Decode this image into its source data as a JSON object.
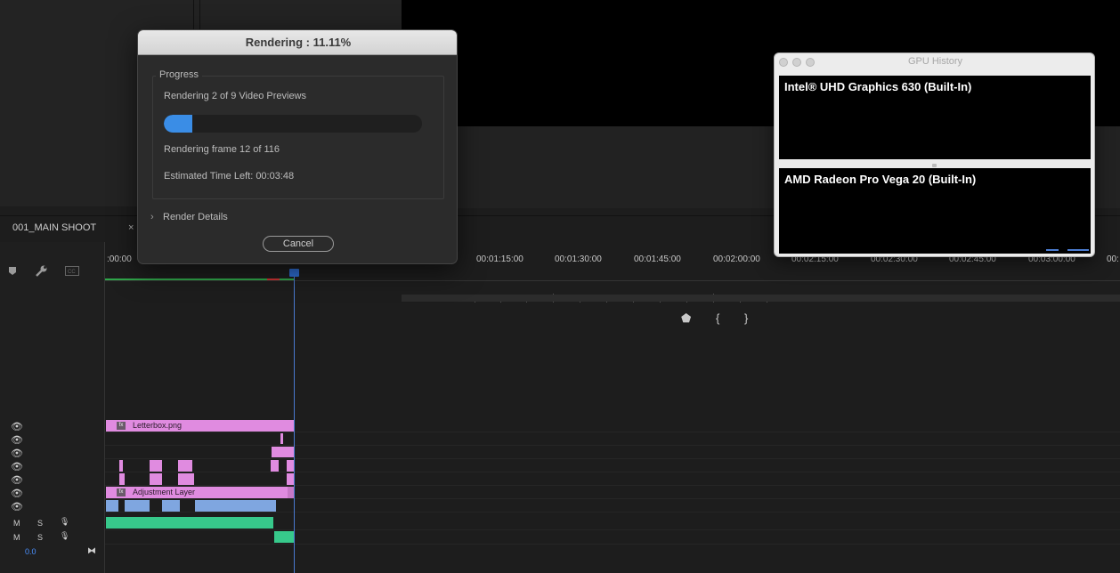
{
  "rendering_dialog": {
    "title": "Rendering : 11.11%",
    "progress_section_label": "Progress",
    "previews_text": "Rendering 2 of 9 Video Previews",
    "progress_percent": 11.11,
    "frame_text": "Rendering frame 12 of 116",
    "time_left_text": "Estimated Time Left: 00:03:48",
    "details_label": "Render Details",
    "cancel_label": "Cancel"
  },
  "gpu_history": {
    "title": "GPU History",
    "gpu1": "Intel® UHD Graphics 630 (Built-In)",
    "gpu2": "AMD Radeon Pro Vega 20 (Built-In)"
  },
  "timeline": {
    "sequence_tab": "001_MAIN SHOOT",
    "close_glyph": "×",
    "timecodes": [
      ":00:00",
      "00:01:15:00",
      "00:01:30:00",
      "00:01:45:00",
      "00:02:00:00",
      "00:02:15:00",
      "00:02:30:00",
      "00:02:45:00",
      "00:03:00:00",
      "00:"
    ],
    "clips": {
      "letterbox": "Letterbox.png",
      "adjustment": "Adjustment Layer",
      "fx_badge": "fx"
    },
    "track_labels": {
      "mute": "M",
      "solo": "S",
      "volume": "0.0"
    }
  },
  "monitor": {
    "marker_glyph": "⬟",
    "in_glyph": "{",
    "out_glyph": "}"
  },
  "colors": {
    "progress_fill": "#3a8de6",
    "clip_pink": "#e08be0",
    "clip_blue": "#7fa6e0",
    "clip_green": "#37c98b",
    "playhead": "#2f6fd6"
  }
}
